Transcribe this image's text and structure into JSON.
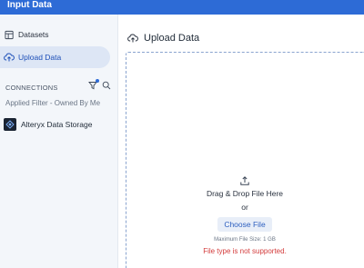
{
  "window": {
    "title": "Input Data"
  },
  "sidebar": {
    "items": [
      {
        "label": "Datasets",
        "icon": "datasets-icon"
      },
      {
        "label": "Upload Data",
        "icon": "cloud-upload-icon",
        "active": true
      }
    ],
    "connections": {
      "header": "CONNECTIONS",
      "applied_filter": "Applied Filter - Owned By Me",
      "items": [
        {
          "label": "Alteryx Data Storage",
          "icon": "alteryx-logo-icon"
        }
      ]
    }
  },
  "main": {
    "title": "Upload Data",
    "dropzone": {
      "drag_text": "Drag & Drop File Here",
      "or_text": "or",
      "choose_label": "Choose File",
      "max_size": "Maximum File Size: 1 GB",
      "error": "File type is not supported."
    }
  },
  "colors": {
    "accent": "#2d6bd6",
    "sidebar_bg": "#f3f6fa",
    "active_bg": "#dde6f5",
    "error": "#d33b3b"
  }
}
